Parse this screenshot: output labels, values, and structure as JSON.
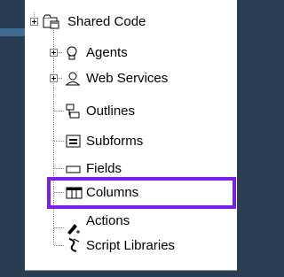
{
  "tree": {
    "root": {
      "label": "Shared Code",
      "icon": "shared-code-folder-icon"
    },
    "items": [
      {
        "label": "Agents",
        "icon": "agent-lightbulb-icon"
      },
      {
        "label": "Web Services",
        "icon": "web-service-icon"
      },
      {
        "label": "Outlines",
        "icon": "outline-icon"
      },
      {
        "label": "Subforms",
        "icon": "subform-icon"
      },
      {
        "label": "Fields",
        "icon": "field-icon"
      },
      {
        "label": "Columns",
        "icon": "columns-icon",
        "highlighted": true
      },
      {
        "label": "Actions",
        "icon": "actions-icon"
      },
      {
        "label": "Script Libraries",
        "icon": "script-library-icon"
      }
    ]
  },
  "colors": {
    "highlight": "#7a1ee8",
    "background": "#2b3d54",
    "tree_background": "#ffffff"
  }
}
